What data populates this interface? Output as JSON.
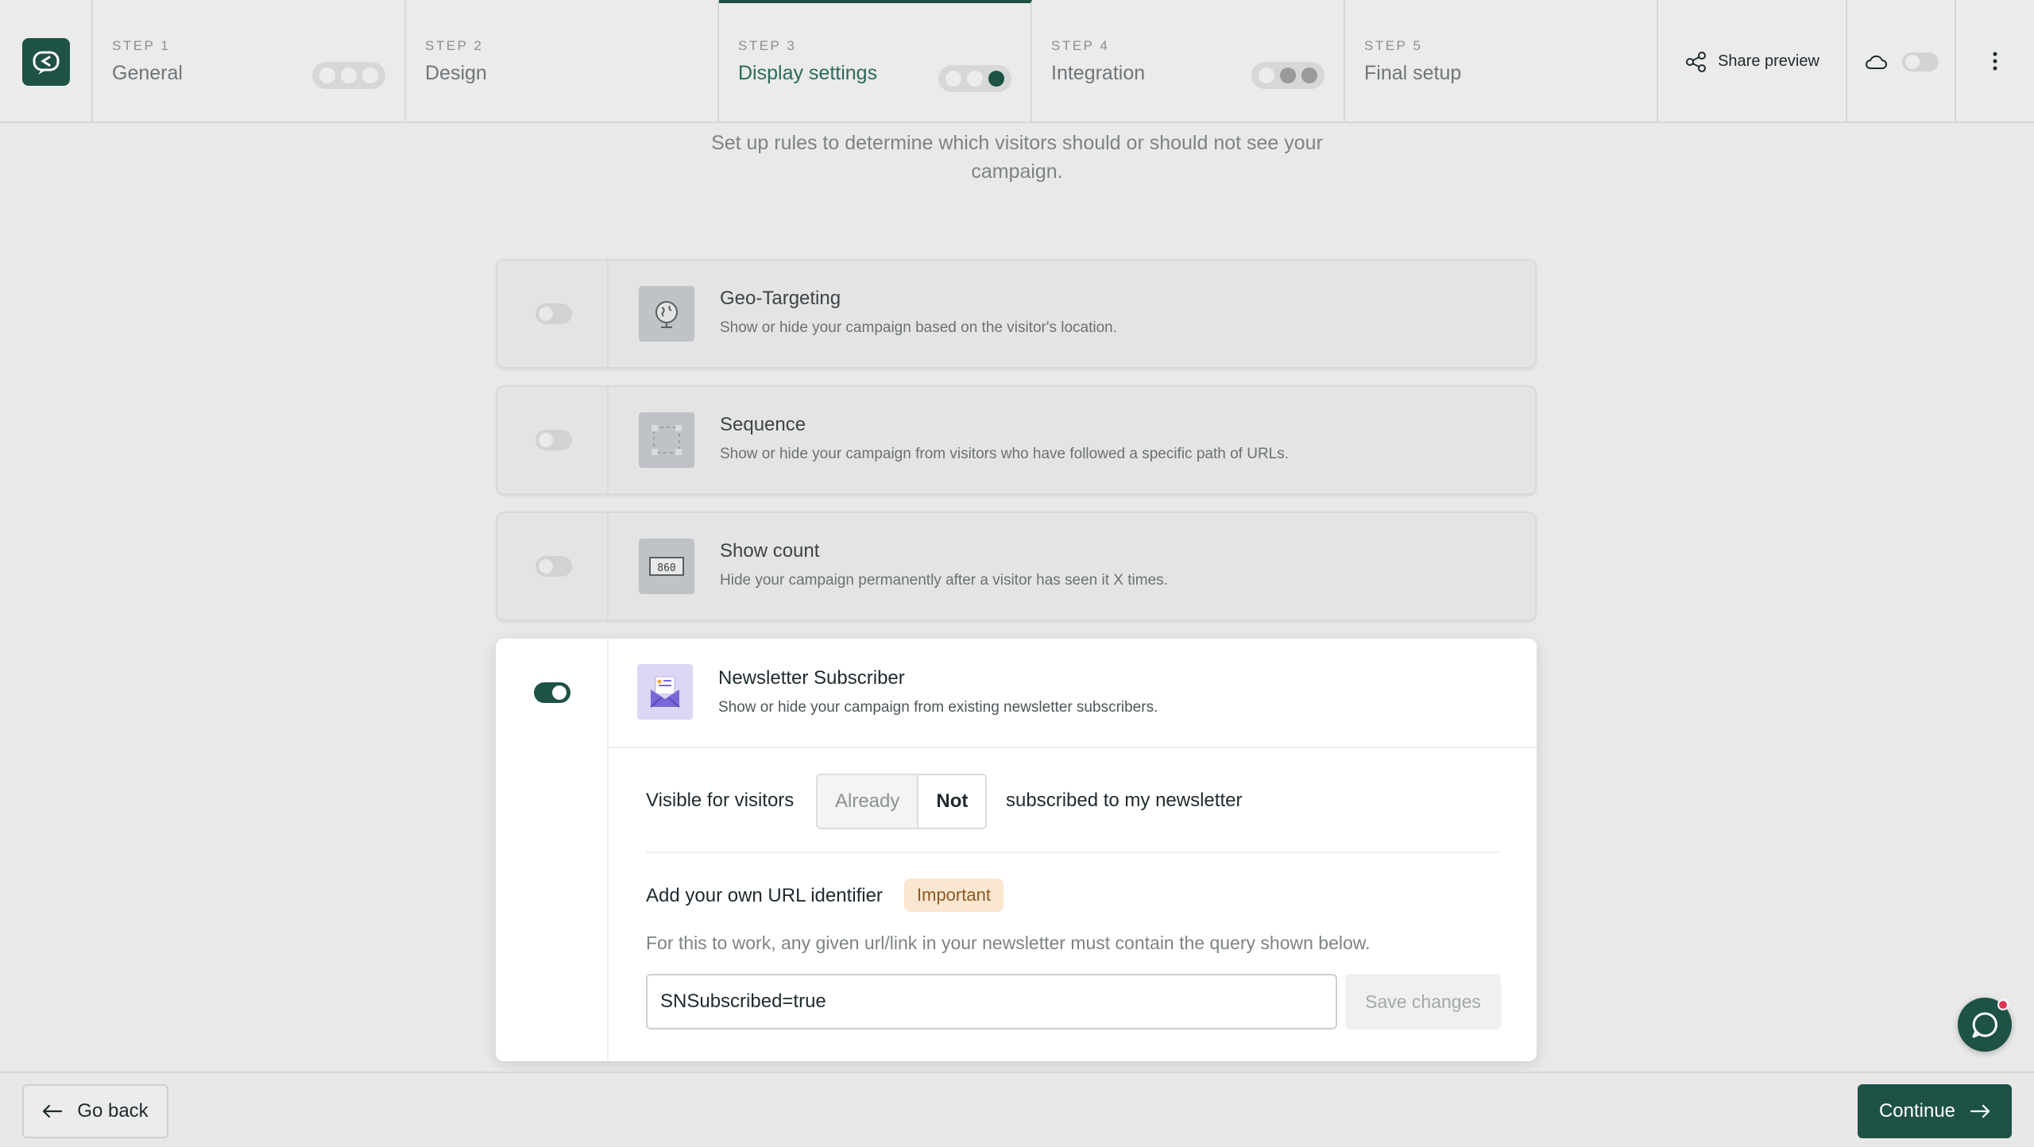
{
  "steps": [
    {
      "num": "STEP 1",
      "name": "General",
      "dots": [
        "light",
        "light",
        "light"
      ]
    },
    {
      "num": "STEP 2",
      "name": "Design",
      "dots": []
    },
    {
      "num": "STEP 3",
      "name": "Display settings",
      "dots": [
        "light",
        "light",
        "dark"
      ],
      "active": true
    },
    {
      "num": "STEP 4",
      "name": "Integration",
      "dots": [
        "light",
        "mid",
        "mid"
      ]
    },
    {
      "num": "STEP 5",
      "name": "Final setup",
      "dots": []
    }
  ],
  "header": {
    "share_label": "Share preview",
    "share_icon": "share-icon",
    "cloud_icon": "cloud-icon",
    "more_icon": "vertical-dots-icon"
  },
  "intro": "Set up rules to determine which visitors should or should not see your campaign.",
  "rules": [
    {
      "title": "Geo-Targeting",
      "desc": "Show or hide your campaign based on the visitor's location.",
      "icon": "globe-icon",
      "enabled": false
    },
    {
      "title": "Sequence",
      "desc": "Show or hide your campaign from visitors who have followed a specific path of URLs.",
      "icon": "sequence-icon",
      "enabled": false
    },
    {
      "title": "Show count",
      "desc": "Hide your campaign permanently after a visitor has seen it X times.",
      "icon": "counter-icon",
      "enabled": false
    }
  ],
  "newsletter": {
    "title": "Newsletter Subscriber",
    "desc": "Show or hide your campaign from existing newsletter subscribers.",
    "icon": "newsletter-envelope-icon",
    "enabled": true,
    "visible_label": "Visible for visitors",
    "options": [
      "Already",
      "Not"
    ],
    "selected": "Not",
    "suffix": "subscribed to my newsletter",
    "url_label": "Add your own URL identifier",
    "badge": "Important",
    "help": "For this to work, any given url/link in your newsletter must contain the query shown below.",
    "input_value": "SNSubscribed=true",
    "save_label": "Save changes"
  },
  "footer": {
    "back_label": "Go back",
    "continue_label": "Continue"
  },
  "colors": {
    "brand": "#1e5246",
    "badge_bg": "#fbe6cf",
    "badge_text": "#8a5a22",
    "notification": "#e0334f"
  }
}
